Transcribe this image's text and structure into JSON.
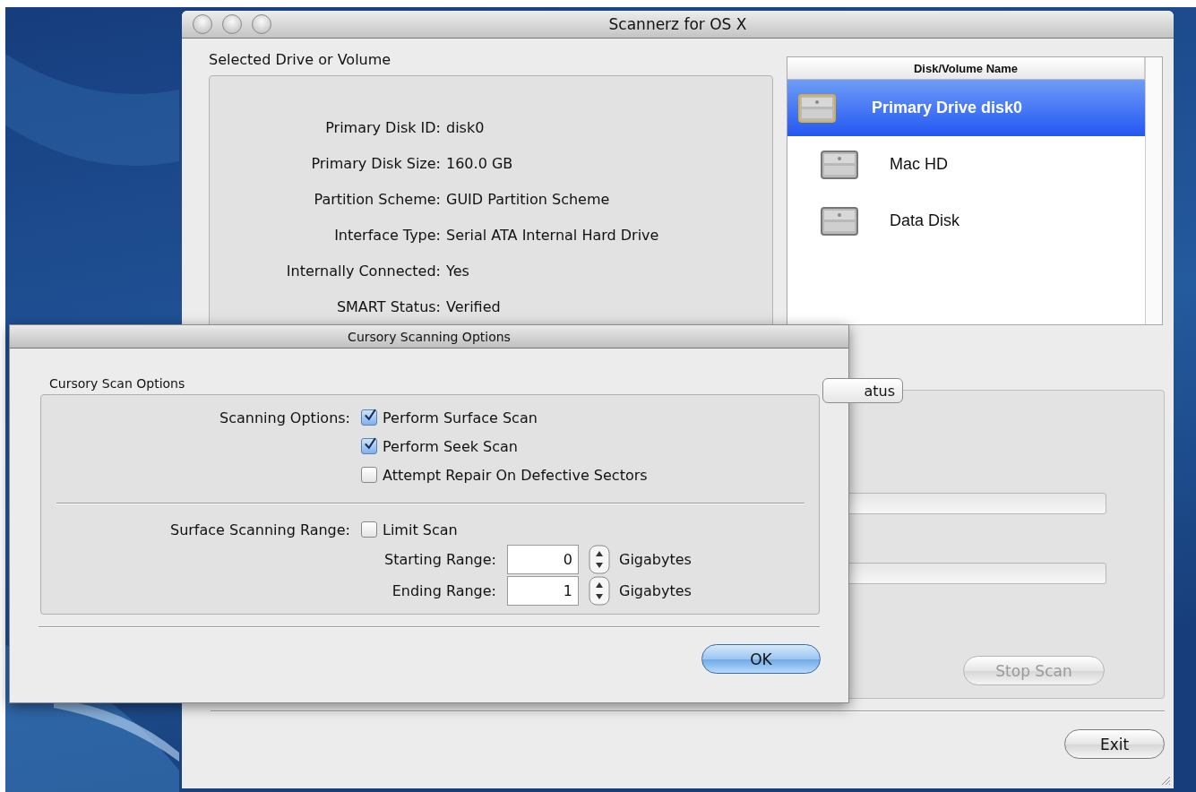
{
  "window": {
    "title": "Scannerz for OS X"
  },
  "selected_drive": {
    "heading": "Selected Drive or Volume",
    "fields": [
      {
        "label": "Primary Disk ID:",
        "value": "disk0"
      },
      {
        "label": "Primary Disk Size:",
        "value": "160.0 GB"
      },
      {
        "label": "Partition Scheme:",
        "value": "GUID Partition Scheme"
      },
      {
        "label": "Interface Type:",
        "value": "Serial ATA Internal Hard Drive"
      },
      {
        "label": "Internally Connected:",
        "value": "Yes"
      },
      {
        "label": "SMART Status:",
        "value": "Verified"
      }
    ]
  },
  "disk_list": {
    "column": "Disk/Volume Name",
    "items": [
      {
        "name": "Primary Drive disk0",
        "selected": true
      },
      {
        "name": "Mac HD",
        "selected": false
      },
      {
        "name": "Data Disk",
        "selected": false
      }
    ]
  },
  "status": {
    "tab": "atus",
    "progress_bars": [
      {
        "level": 0
      },
      {
        "level": 0
      }
    ],
    "stop_button": {
      "label": "Stop Scan",
      "disabled": true
    }
  },
  "exit_button": "Exit",
  "dialog": {
    "title": "Cursory Scanning Options",
    "group": "Cursory Scan Options",
    "scanning_label": "Scanning Options:",
    "options": [
      {
        "label": "Perform Surface Scan",
        "checked": true
      },
      {
        "label": "Perform Seek Scan",
        "checked": true
      },
      {
        "label": "Attempt Repair On Defective Sectors",
        "checked": false
      }
    ],
    "range_label": "Surface Scanning Range:",
    "limit": {
      "label": "Limit Scan",
      "checked": false
    },
    "ranges": [
      {
        "label": "Starting Range:",
        "value": "0",
        "unit": "Gigabytes"
      },
      {
        "label": "Ending Range:",
        "value": "1",
        "unit": "Gigabytes"
      }
    ],
    "ok_button": "OK"
  }
}
